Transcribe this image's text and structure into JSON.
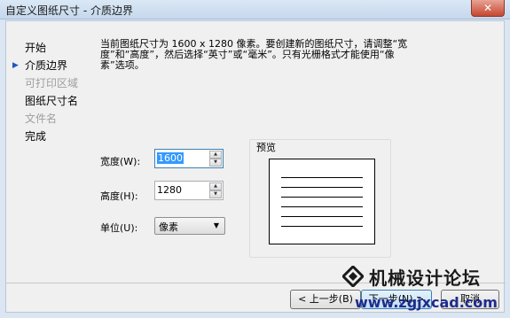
{
  "window": {
    "title": "自定义图纸尺寸 - 介质边界",
    "close_glyph": "✕"
  },
  "steps": [
    {
      "label": "开始",
      "state": "done"
    },
    {
      "label": "介质边界",
      "state": "current"
    },
    {
      "label": "可打印区域",
      "state": "disabled"
    },
    {
      "label": "图纸尺寸名",
      "state": "done"
    },
    {
      "label": "文件名",
      "state": "disabled"
    },
    {
      "label": "完成",
      "state": "done"
    }
  ],
  "description": "当前图纸尺寸为 1600 x 1280 像素。要创建新的图纸尺寸，请调整“宽度”和“高度”，然后选择“英寸”或“毫米”。只有光栅格式才能使用“像素”选项。",
  "fields": {
    "width": {
      "label": "宽度(W):",
      "value": "1600"
    },
    "height": {
      "label": "高度(H):",
      "value": "1280"
    },
    "units": {
      "label": "单位(U):",
      "value": "像素"
    }
  },
  "preview": {
    "label": "预览"
  },
  "buttons": {
    "back": "< 上一步(B)",
    "next": "下一步(N) >",
    "cancel": "取消"
  },
  "watermark": {
    "name": "机械设计论坛",
    "url": "www.zgjxcad.com"
  },
  "colors": {
    "accent": "#3399ff",
    "titlebar": "#c6d8ec",
    "close": "#c6462f"
  }
}
